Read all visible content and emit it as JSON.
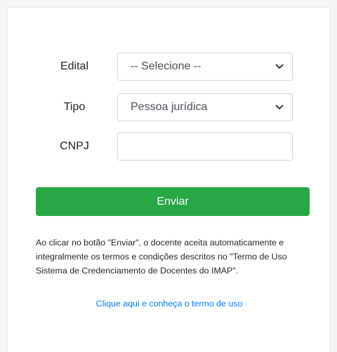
{
  "form": {
    "edital": {
      "label": "Edital",
      "selected": "-- Selecione --"
    },
    "tipo": {
      "label": "Tipo",
      "selected": "Pessoa jurídica"
    },
    "cnpj": {
      "label": "CNPJ",
      "value": ""
    },
    "submit_label": "Enviar"
  },
  "disclaimer": "Ao clicar no botão \"Enviar\", o docente aceita automaticamente e integralmente os termos e condições descritos no \"Termo de Uso Sistema de Credenciamento de Docentes do IMAP\".",
  "terms_link": "Clique aqui e conheça o termo de uso",
  "colors": {
    "submit": "#28a745",
    "link": "#007bff"
  },
  "icons": {
    "select_arrow": "chevron-down-icon"
  }
}
